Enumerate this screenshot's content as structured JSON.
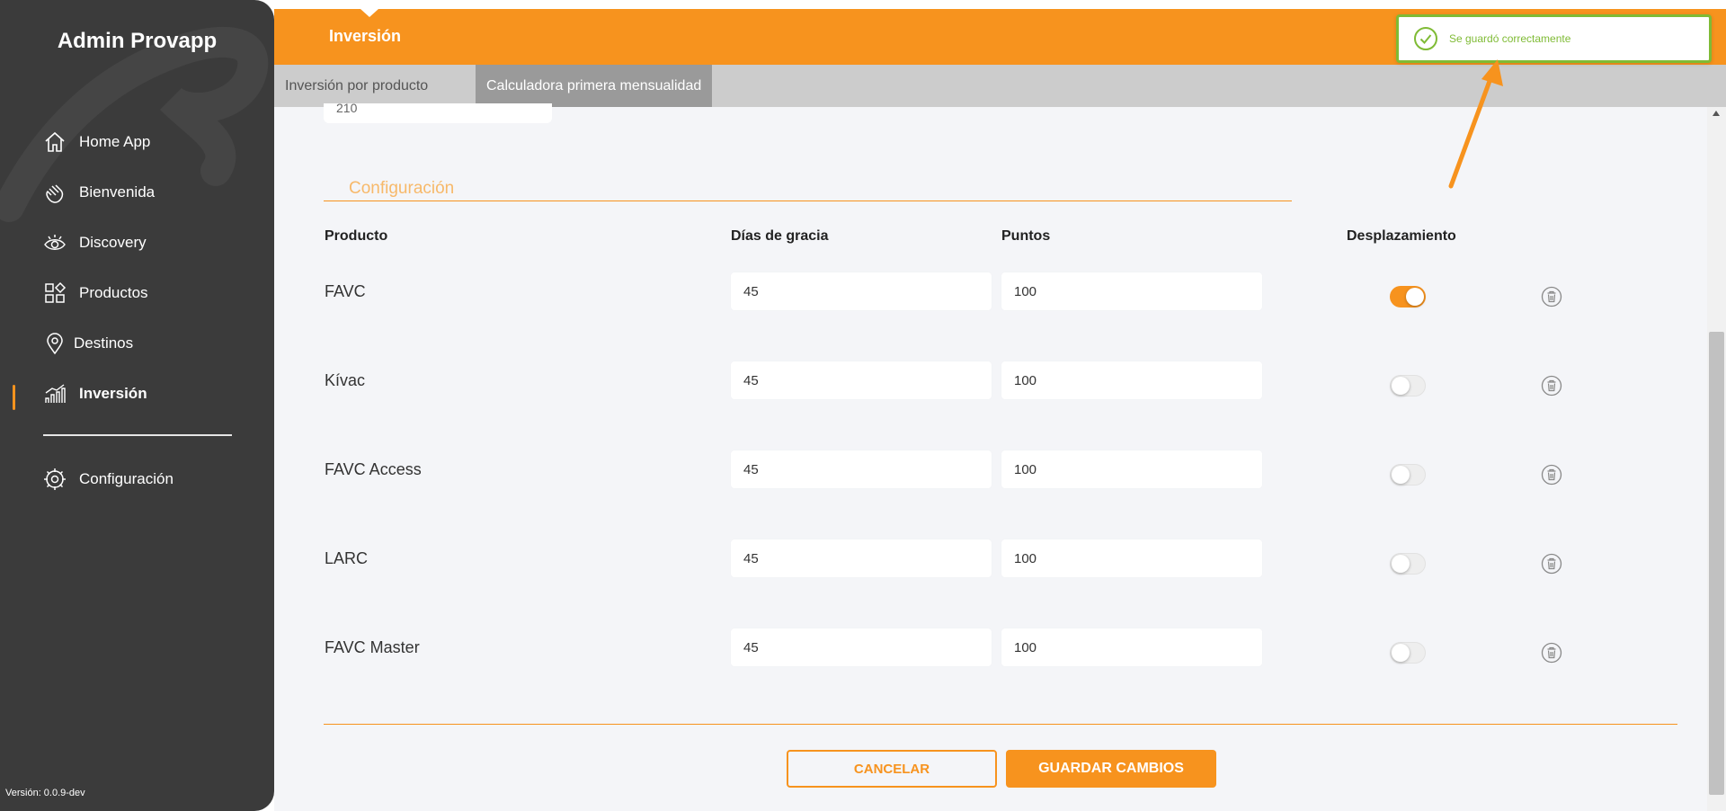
{
  "sidebar": {
    "brand": "Admin Provapp",
    "items": [
      {
        "label": "Home App",
        "icon": "home-icon"
      },
      {
        "label": "Bienvenida",
        "icon": "wave-hand-icon"
      },
      {
        "label": "Discovery",
        "icon": "eye-icon"
      },
      {
        "label": "Productos",
        "icon": "grid-icon"
      },
      {
        "label": "Destinos",
        "icon": "map-pin-icon"
      },
      {
        "label": "Inversión",
        "icon": "bar-chart-icon",
        "active": true
      }
    ],
    "settings": {
      "label": "Configuración",
      "icon": "gear-icon"
    },
    "version": "Versión: 0.0.9-dev"
  },
  "header": {
    "title": "Inversión",
    "tabs": [
      {
        "label": "Inversión por producto",
        "active": false
      },
      {
        "label": "Calculadora primera mensualidad",
        "active": true
      }
    ]
  },
  "main": {
    "partial_input_value": "210",
    "section_title": "Configuración",
    "columns": {
      "product": "Producto",
      "grace_days": "Días de gracia",
      "points": "Puntos",
      "displacement": "Desplazamiento"
    },
    "rows": [
      {
        "product": "FAVC",
        "grace_days": "45",
        "points": "100",
        "displacement": true
      },
      {
        "product": "Kívac",
        "grace_days": "45",
        "points": "100",
        "displacement": false
      },
      {
        "product": "FAVC Access",
        "grace_days": "45",
        "points": "100",
        "displacement": false
      },
      {
        "product": "LARC",
        "grace_days": "45",
        "points": "100",
        "displacement": false
      },
      {
        "product": "FAVC Master",
        "grace_days": "45",
        "points": "100",
        "displacement": false
      }
    ],
    "cancel_label": "CANCELAR",
    "save_label": "GUARDAR CAMBIOS"
  },
  "toast": {
    "message": "Se guardó correctamente",
    "icon": "check-circle-icon"
  },
  "colors": {
    "accent": "#f7931e",
    "sidebar": "#3b3b3b",
    "success": "#7fbb35"
  }
}
